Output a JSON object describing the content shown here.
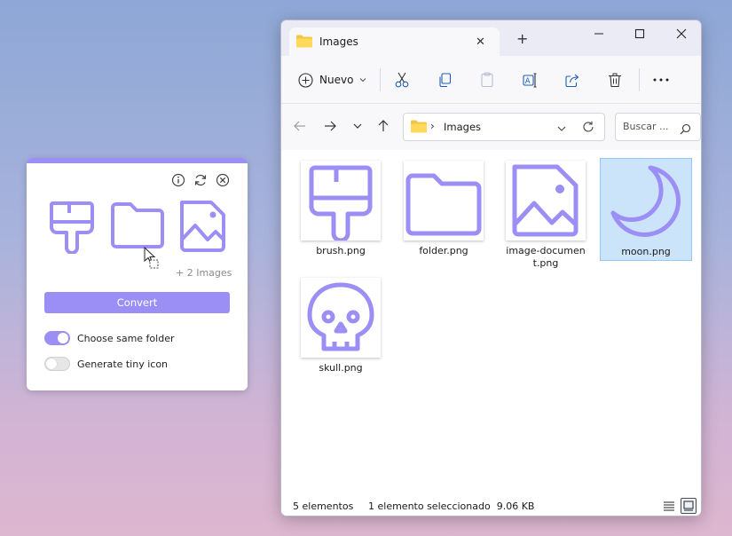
{
  "widget": {
    "accent": "#9b8ff5",
    "controls": [
      "info-icon",
      "refresh-icon",
      "close-icon"
    ],
    "preview_icons": [
      "brush-icon",
      "folder-icon",
      "image-document-icon"
    ],
    "more_label": "+ 2 Images",
    "convert_label": "Convert",
    "options": [
      {
        "label": "Choose same folder",
        "enabled": true
      },
      {
        "label": "Generate tiny icon",
        "enabled": false
      }
    ]
  },
  "explorer": {
    "tab_title": "Images",
    "toolbar": {
      "new_label": "Nuevo",
      "actions": [
        "cut-icon",
        "copy-icon",
        "paste-icon",
        "rename-icon",
        "share-icon",
        "delete-icon",
        "more-icon"
      ]
    },
    "address": {
      "path": "Images"
    },
    "search": {
      "placeholder": "Buscar ..."
    },
    "files": [
      {
        "name": "brush.png",
        "icon": "brush-icon",
        "selected": false
      },
      {
        "name": "folder.png",
        "icon": "folder-icon",
        "selected": false
      },
      {
        "name": "image-document.png",
        "display_name": "image-documen\nt.png",
        "icon": "image-document-icon",
        "selected": false
      },
      {
        "name": "moon.png",
        "icon": "moon-icon",
        "selected": true
      },
      {
        "name": "skull.png",
        "icon": "skull-icon",
        "selected": false
      }
    ],
    "status": {
      "count": "5 elementos",
      "selection": "1 elemento seleccionado  9.06 KB"
    }
  }
}
